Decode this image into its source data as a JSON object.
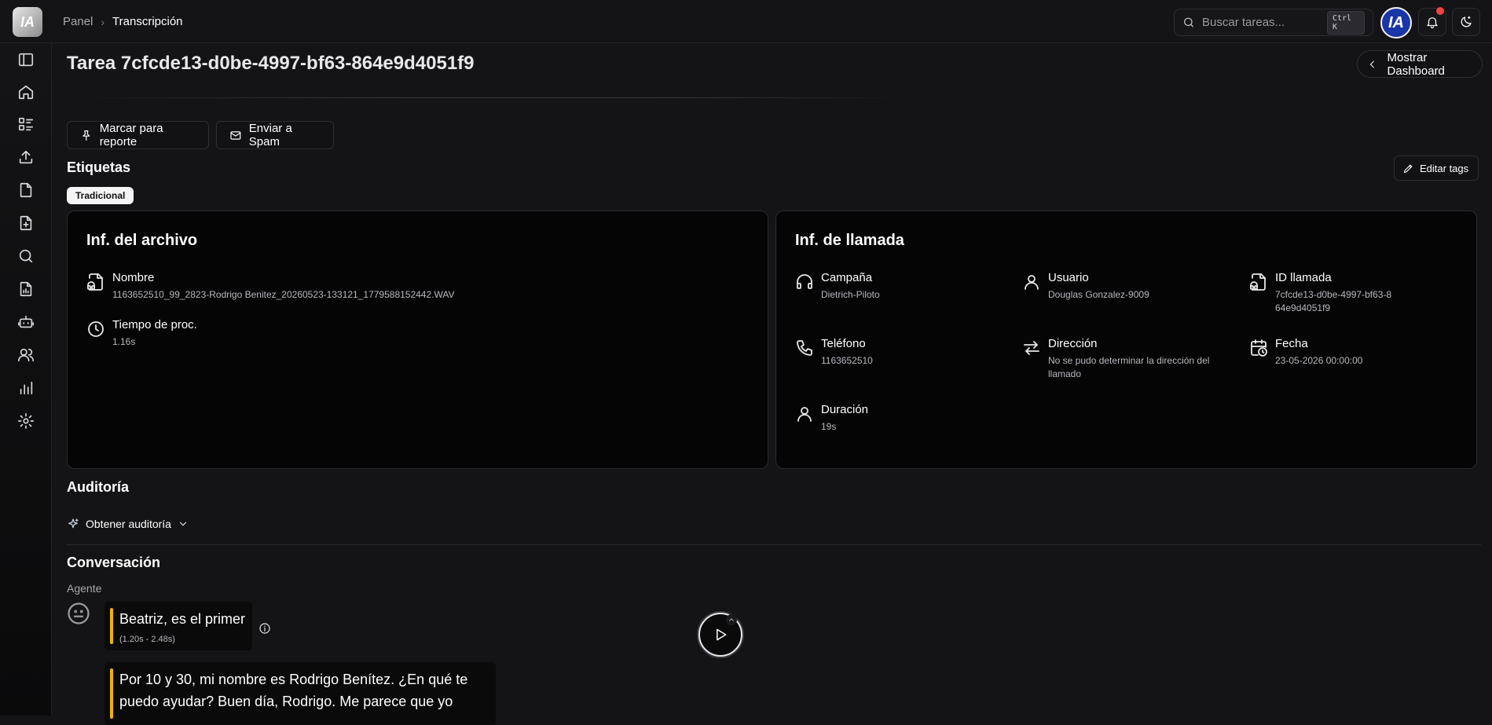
{
  "app": {
    "logo_text": "IA"
  },
  "breadcrumb": {
    "items": [
      "Panel"
    ],
    "separator": "›",
    "current": "Transcripción"
  },
  "search": {
    "placeholder": "Buscar tareas...",
    "shortcut": "Ctrl K"
  },
  "user": {
    "avatar_text": "IA"
  },
  "colors": {
    "accent_bar": "#eab308",
    "notification": "#ef4444",
    "avatar_bg": "#1a35a8"
  },
  "sidebar": {
    "items": [
      "toggle-sidebar-icon",
      "home-icon",
      "tasks-icon",
      "upload-icon",
      "file-icon",
      "file-add-icon",
      "search-icon",
      "report-icon",
      "robot-icon",
      "users-icon",
      "chart-icon",
      "settings-icon"
    ]
  },
  "page": {
    "title": "Tarea 7cfcde13-d0be-4997-bf63-864e9d4051f9",
    "dashboard_button": "Mostrar Dashboard",
    "actions": {
      "report": "Marcar para reporte",
      "spam": "Enviar a Spam"
    }
  },
  "tags": {
    "heading": "Etiquetas",
    "edit_label": "Editar tags",
    "items": [
      "Tradicional"
    ]
  },
  "file_info": {
    "title": "Inf. del archivo",
    "name_label": "Nombre",
    "name_value": "1163652510_99_2823-Rodrigo Benitez_20260523-133121_1779588152442.WAV",
    "proc_label": "Tiempo de proc.",
    "proc_value": "1.16s"
  },
  "call_info": {
    "title": "Inf. de llamada",
    "campaign_label": "Campaña",
    "campaign_value": "Dietrich-Piloto",
    "user_label": "Usuario",
    "user_value": "Douglas Gonzalez-9009",
    "callid_label": "ID llamada",
    "callid_value": "7cfcde13-d0be-4997-bf63-864e9d4051f9",
    "phone_label": "Teléfono",
    "phone_value": "1163652510",
    "direction_label": "Dirección",
    "direction_value": "No se pudo determinar la dirección del llamado",
    "date_label": "Fecha",
    "date_value": "23-05-2026 00:00:00",
    "duration_label": "Duración",
    "duration_value": "19s"
  },
  "audit": {
    "heading": "Auditoría",
    "button": "Obtener auditoría"
  },
  "conversation": {
    "heading": "Conversación",
    "speaker": "Agente",
    "messages": [
      {
        "text": "Beatriz, es el primer",
        "time": "(1.20s - 2.48s)"
      },
      {
        "text": "Por 10 y 30, mi nombre es Rodrigo Benítez. ¿En qué te puedo ayudar? Buen día, Rodrigo. Me parece que yo",
        "time": ""
      }
    ]
  }
}
